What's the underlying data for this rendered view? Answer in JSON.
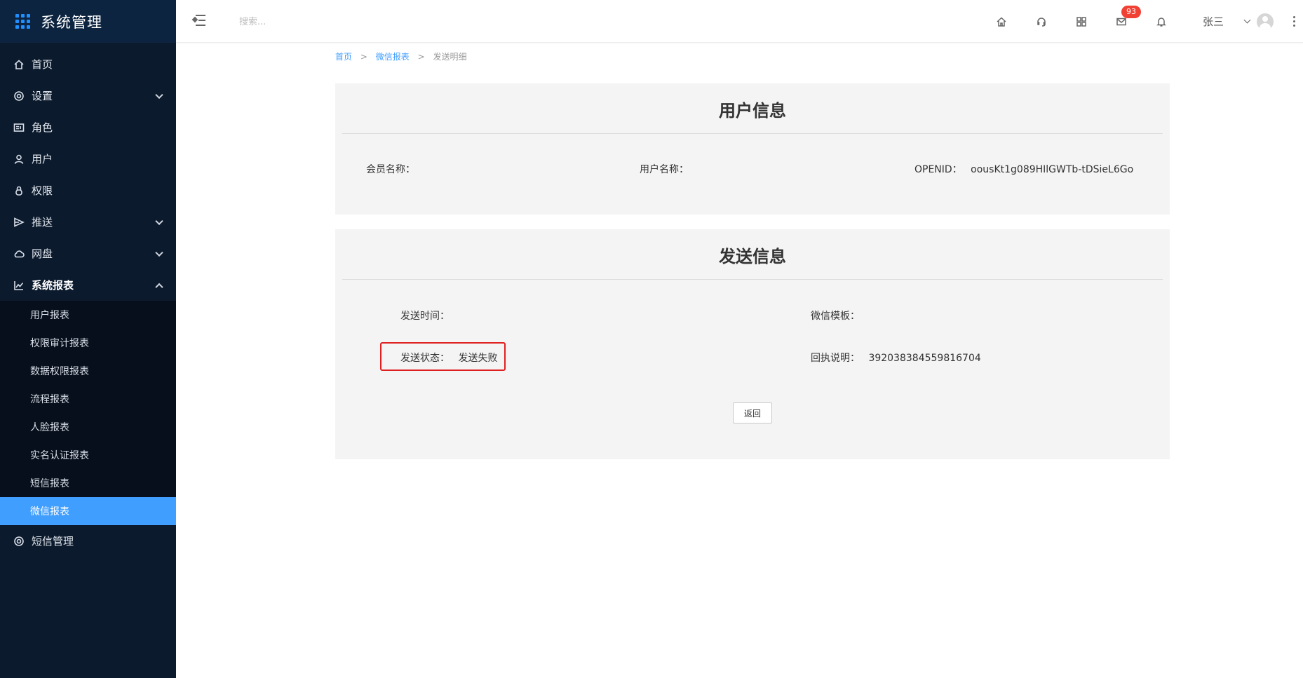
{
  "app": {
    "title": "系统管理"
  },
  "sidebar": {
    "items": [
      {
        "label": "首页",
        "icon": "home-icon"
      },
      {
        "label": "设置",
        "icon": "gear-icon",
        "has_children": true
      },
      {
        "label": "角色",
        "icon": "role-card-icon"
      },
      {
        "label": "用户",
        "icon": "user-icon"
      },
      {
        "label": "权限",
        "icon": "lock-icon"
      },
      {
        "label": "推送",
        "icon": "send-icon",
        "has_children": true
      },
      {
        "label": "网盘",
        "icon": "cloud-icon",
        "has_children": true
      },
      {
        "label": "系统报表",
        "icon": "chart-line-icon",
        "has_children": true,
        "expanded": true
      },
      {
        "label": "短信管理",
        "icon": "gear-icon"
      }
    ],
    "report_submenu": [
      {
        "label": "用户报表"
      },
      {
        "label": "权限审计报表"
      },
      {
        "label": "数据权限报表"
      },
      {
        "label": "流程报表"
      },
      {
        "label": "人脸报表"
      },
      {
        "label": "实名认证报表"
      },
      {
        "label": "短信报表"
      },
      {
        "label": "微信报表",
        "active": true
      }
    ]
  },
  "topbar": {
    "search_placeholder": "搜索...",
    "mail_badge": "93",
    "user_name": "张三"
  },
  "breadcrumb": {
    "home": "首页",
    "parent": "微信报表",
    "current": "发送明细",
    "separator": ">"
  },
  "user_info": {
    "title": "用户信息",
    "member_name_label": "会员名称：",
    "member_name_value": "",
    "user_name_label": "用户名称：",
    "user_name_value": "",
    "openid_label": "OPENID：",
    "openid_value": "oousKt1g089HIlGWTb-tDSieL6Go"
  },
  "send_info": {
    "title": "发送信息",
    "send_time_label": "发送时间：",
    "send_time_value": "",
    "template_label": "微信模板：",
    "template_value": "",
    "status_label": "发送状态：",
    "status_value": "发送失败",
    "receipt_label": "回执说明：",
    "receipt_value": "392038384559816704",
    "back_button": "返回"
  },
  "colors": {
    "sidebar_bg": "#0b1a2d",
    "active_item": "#409eff",
    "badge": "#f04134",
    "highlight_border": "#e02020",
    "panel_bg": "#f4f4f4"
  }
}
